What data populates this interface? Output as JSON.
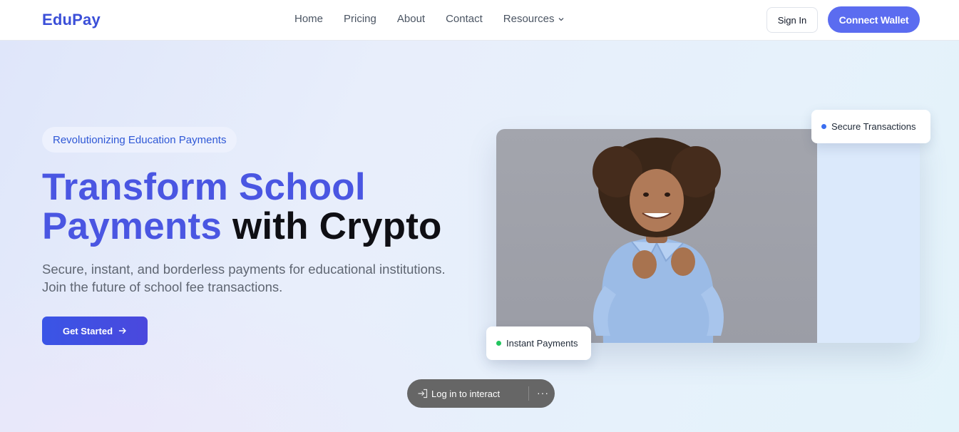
{
  "nav": {
    "logo": "EduPay",
    "links": [
      "Home",
      "Pricing",
      "About",
      "Contact",
      "Resources"
    ],
    "signin_label": "Sign In",
    "connect_label": "Connect Wallet"
  },
  "hero": {
    "pill": "Revolutionizing Education Payments",
    "headline_line1": "Transform School",
    "headline_grad2": "Payments",
    "headline_dark": "with Crypto",
    "subtitle_line1": "Secure, instant, and borderless payments for educational institutions.",
    "subtitle_line2": "Join the future of school fee transactions.",
    "cta_label": "Get Started"
  },
  "badges": {
    "secure": "Secure Transactions",
    "instant": "Instant Payments"
  },
  "login_bar": {
    "label": "Log in to interact",
    "more": "···"
  },
  "colors": {
    "brand": "#3b4fd8",
    "accent": "#5b6cf0",
    "secure_dot": "#3b6ef0",
    "instant_dot": "#22c55e"
  }
}
